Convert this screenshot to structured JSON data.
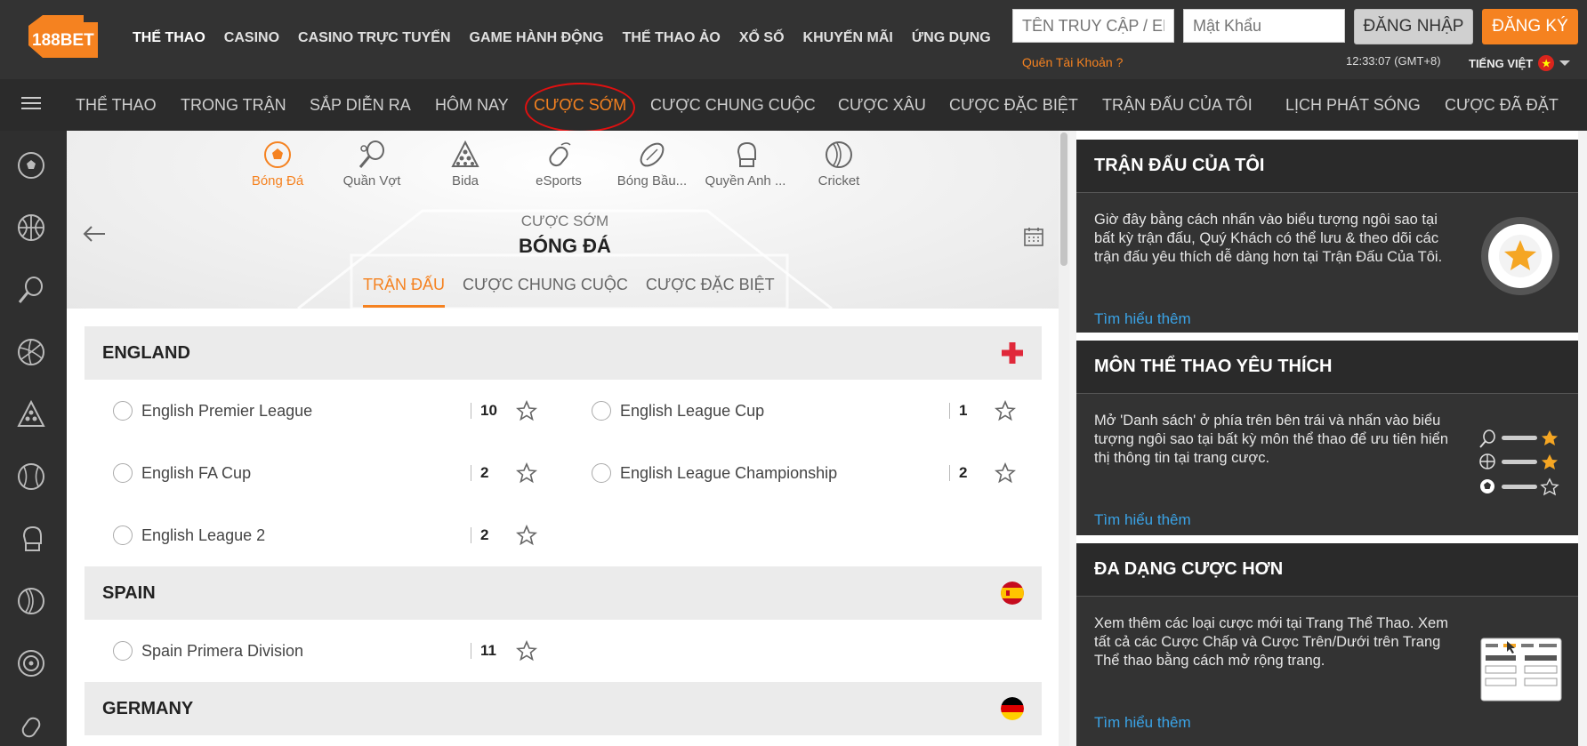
{
  "brand": {
    "logo_text": "188BET"
  },
  "top_nav": [
    "THỂ THAO",
    "CASINO",
    "CASINO TRỰC TUYẾN",
    "GAME HÀNH ĐỘNG",
    "THỂ THAO ẢO",
    "XỔ SỐ",
    "KHUYẾN MÃI",
    "ỨNG DỤNG"
  ],
  "login": {
    "username_placeholder": "TÊN TRUY CẬP / EMAIL",
    "password_placeholder": "Mật Khẩu",
    "login_label": "ĐĂNG NHẬP",
    "register_label": "ĐĂNG KÝ",
    "forgot_label": "Quên Tài Khoản ?",
    "clock": "12:33:07 (GMT+8)",
    "language": "TIẾNG VIỆT"
  },
  "sub_nav": [
    "THỂ THAO",
    "TRONG TRẬN",
    "SẮP DIỄN RA",
    "HÔM NAY",
    "CƯỢC SỚM",
    "CƯỢC CHUNG CUỘC",
    "CƯỢC XÂU",
    "CƯỢC ĐẶC BIỆT",
    "TRẬN ĐẤU CỦA TÔI",
    "LỊCH PHÁT SÓNG",
    "CƯỢC ĐÃ ĐẶT"
  ],
  "sport_tabs": [
    {
      "label": "Bóng Đá",
      "icon": "soccer-icon"
    },
    {
      "label": "Quần Vợt",
      "icon": "tennis-icon"
    },
    {
      "label": "Bida",
      "icon": "billiards-icon"
    },
    {
      "label": "eSports",
      "icon": "mouse-icon"
    },
    {
      "label": "Bóng Bầu...",
      "icon": "rugby-icon"
    },
    {
      "label": "Quyền Anh ...",
      "icon": "boxing-icon"
    },
    {
      "label": "Cricket",
      "icon": "cricket-icon"
    }
  ],
  "hero": {
    "subtitle": "CƯỢC SỚM",
    "title": "BÓNG ĐÁ",
    "tabs": [
      "TRẬN ĐẤU",
      "CƯỢC CHUNG CUỘC",
      "CƯỢC ĐẶC BIỆT"
    ]
  },
  "countries": [
    {
      "name": "ENGLAND",
      "flag": "england",
      "leagues": [
        {
          "name": "English Premier League",
          "count": "10"
        },
        {
          "name": "English League Cup",
          "count": "1"
        },
        {
          "name": "English FA Cup",
          "count": "2"
        },
        {
          "name": "English League Championship",
          "count": "2"
        },
        {
          "name": "English League 2",
          "count": "2"
        }
      ]
    },
    {
      "name": "SPAIN",
      "flag": "spain",
      "leagues": [
        {
          "name": "Spain Primera Division",
          "count": "11"
        }
      ]
    },
    {
      "name": "GERMANY",
      "flag": "germany",
      "leagues": []
    }
  ],
  "right_panel": [
    {
      "title": "TRẬN ĐẤU CỦA TÔI",
      "text": "Giờ đây bằng cách nhấn vào biểu tượng ngôi sao tại bất kỳ trận đấu, Quý Khách có thể lưu & theo dõi các trận đấu yêu thích dễ dàng hơn tại Trận Đấu Của Tôi.",
      "link": "Tìm hiểu thêm"
    },
    {
      "title": "MÔN THỂ THAO YÊU THÍCH",
      "text": "Mở 'Danh sách' ở phía trên bên trái và nhấn vào biểu tượng ngôi sao tại bất kỳ môn thể thao để ưu tiên hiển thị thông tin tại trang cược.",
      "link": "Tìm hiểu thêm"
    },
    {
      "title": "ĐA DẠNG CƯỢC HƠN",
      "text": "Xem thêm các loại cược mới tại Trang Thể Thao. Xem tất cả các Cược Chấp và Cược Trên/Dưới trên Trang Thể thao bằng cách mở rộng trang.",
      "link": "Tìm hiểu thêm"
    }
  ],
  "colors": {
    "accent": "#f58220",
    "link": "#3aa3e6",
    "annotation": "#e01010"
  }
}
